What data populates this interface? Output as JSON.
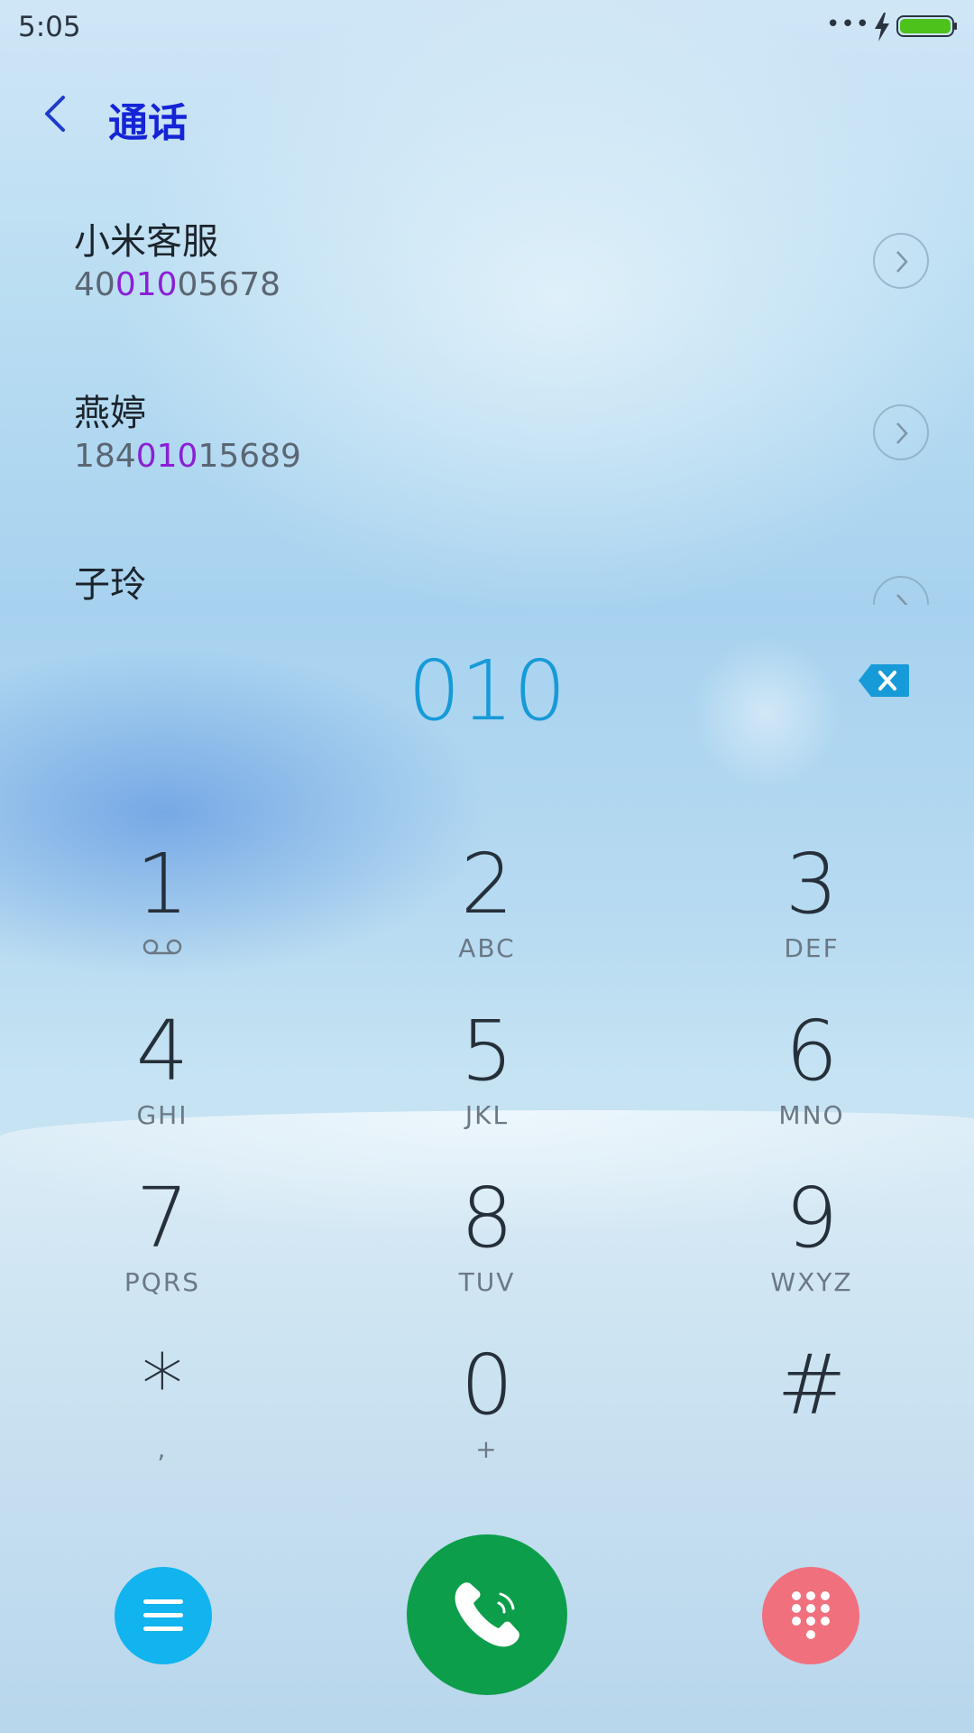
{
  "status_bar": {
    "time": "5:05",
    "more_indicator": "•••",
    "icons": [
      "charging-icon",
      "battery-icon"
    ],
    "battery_color": "#4cc21b"
  },
  "header": {
    "back_icon": "chevron-left-icon",
    "title": "通话",
    "title_color": "#1424d6"
  },
  "contacts": [
    {
      "name": "小米客服",
      "number_parts": [
        "40",
        "010",
        "05678"
      ]
    },
    {
      "name": "燕婷",
      "number_parts": [
        "184",
        "010",
        "15689"
      ]
    },
    {
      "name": "子玲",
      "number_parts": [
        "",
        "",
        ""
      ]
    }
  ],
  "highlight_color": "#8b1fd6",
  "dial_input": "010",
  "dial_input_color": "#179ad8",
  "keypad": [
    {
      "digit": "1",
      "letters": "",
      "icon": "voicemail-icon"
    },
    {
      "digit": "2",
      "letters": "ABC"
    },
    {
      "digit": "3",
      "letters": "DEF"
    },
    {
      "digit": "4",
      "letters": "GHI"
    },
    {
      "digit": "5",
      "letters": "JKL"
    },
    {
      "digit": "6",
      "letters": "MNO"
    },
    {
      "digit": "7",
      "letters": "PQRS"
    },
    {
      "digit": "8",
      "letters": "TUV"
    },
    {
      "digit": "9",
      "letters": "WXYZ"
    },
    {
      "digit": "*",
      "letters": ","
    },
    {
      "digit": "0",
      "letters": "+"
    },
    {
      "digit": "#",
      "letters": ""
    }
  ],
  "bottom_bar": {
    "menu_icon": "menu-icon",
    "menu_color": "#11b4ee",
    "call_icon": "phone-icon",
    "call_color": "#0c9e4a",
    "keypad_icon": "dialpad-icon",
    "keypad_color": "#f0707e"
  }
}
